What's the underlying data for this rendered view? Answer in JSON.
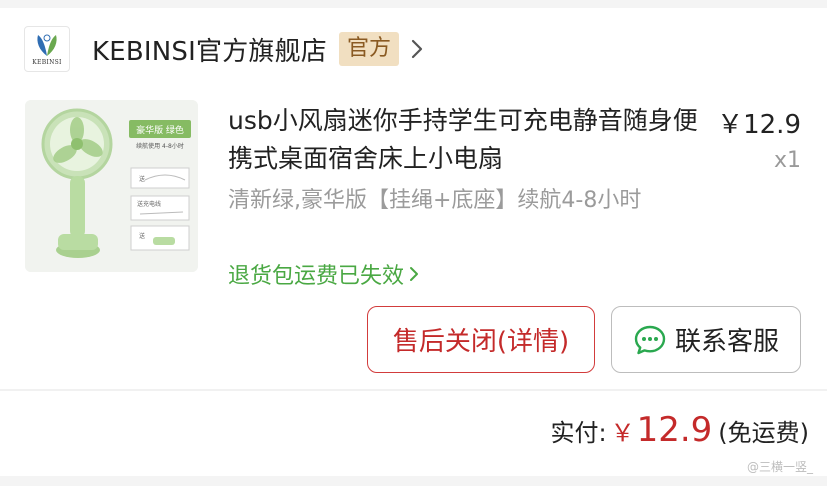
{
  "store": {
    "logo_text": "KEBINSI",
    "name": "KEBINSI官方旗舰店",
    "badge": "官方"
  },
  "product": {
    "image_alt": "mini handheld fan",
    "title": "usb小风扇迷你手持学生可充电静音随身便携式桌面宿舍床上小电扇",
    "price": "￥12.9",
    "quantity": "x1",
    "spec": "清新绿,豪华版【挂绳+底座】续航4-8小时",
    "refund_note": "退货包运费已失效",
    "image_labels": [
      "豪华版  绿色",
      "续航使用 4-8小时",
      "送",
      "送充电线",
      "送"
    ]
  },
  "actions": {
    "aftersale_label": "售后关闭(详情)",
    "service_label": "联系客服"
  },
  "summary": {
    "total_label": "实付:",
    "currency": "￥",
    "total_amount": "12.9",
    "shipping_note": "(免运费)"
  },
  "watermark": "@三横一竖_",
  "colors": {
    "accent_red": "#c42a2a",
    "green": "#4aa843",
    "badge_bg": "#f1dfc1",
    "badge_text": "#8a5a22"
  },
  "icons": {
    "store_chevron": "chevron-right-icon",
    "refund_chevron": "chevron-right-icon",
    "service_icon": "chat-bubble-icon"
  }
}
